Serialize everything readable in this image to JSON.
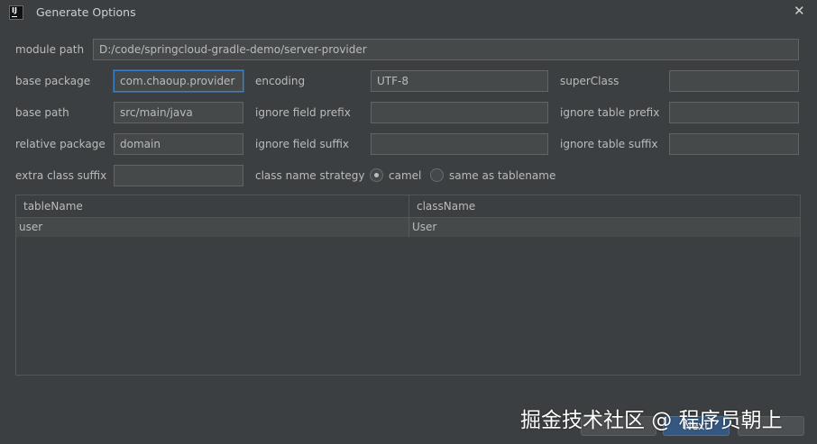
{
  "window": {
    "title": "Generate Options",
    "icon_text": "IJ"
  },
  "form": {
    "module_path": {
      "label": "module path",
      "value": "D:/code/springcloud-gradle-demo/server-provider"
    },
    "base_package": {
      "label": "base package",
      "value": "com.chaoup.provider"
    },
    "encoding": {
      "label": "encoding",
      "value": "UTF-8"
    },
    "superclass": {
      "label": "superClass",
      "value": ""
    },
    "base_path": {
      "label": "base path",
      "value": "src/main/java"
    },
    "ignore_field_prefix": {
      "label": "ignore field prefix",
      "value": ""
    },
    "ignore_table_prefix": {
      "label": "ignore table prefix",
      "value": ""
    },
    "relative_package": {
      "label": "relative package",
      "value": "domain"
    },
    "ignore_field_suffix": {
      "label": "ignore field suffix",
      "value": ""
    },
    "ignore_table_suffix": {
      "label": "ignore table suffix",
      "value": ""
    },
    "extra_class_suffix": {
      "label": "extra class suffix",
      "value": ""
    },
    "class_name_strategy": {
      "label": "class name strategy",
      "selected": "camel",
      "options": [
        "camel",
        "same as tablename"
      ]
    }
  },
  "table": {
    "columns": [
      "tableName",
      "className"
    ],
    "rows": [
      [
        "user",
        "User"
      ]
    ]
  },
  "buttons": {
    "next_label": "Next"
  },
  "watermark": "掘金技术社区 @ 程序员朝上",
  "colors": {
    "background": "#3c3f41",
    "field_bg": "#45494a",
    "focus": "#3d7ecb",
    "default_button": "#365880"
  }
}
